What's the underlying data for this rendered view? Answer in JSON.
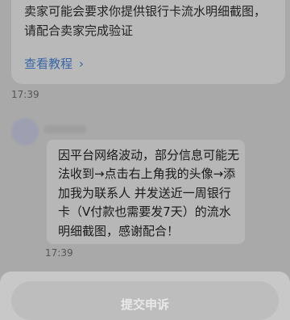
{
  "top_card": {
    "text": "卖家可能会要求你提供银行卡流水明细截图，请配合卖家完成验证",
    "link_label": "查看教程",
    "link_icon": "chevron-right-icon"
  },
  "messages": [
    {
      "time": "17:39"
    },
    {
      "time": "17:39",
      "text": "因平台网络波动，部分信息可能无法收到→点击右上角我的头像→添加我为联系人 并发送近一周银行卡（V付款也需要发7天）的流水明细截图，感谢配合！"
    }
  ],
  "footer": {
    "submit_label": "提交申诉"
  },
  "colors": {
    "overlay": "#a9a9a9",
    "link": "#3a67a7",
    "bubble": "#b7b7b7"
  }
}
